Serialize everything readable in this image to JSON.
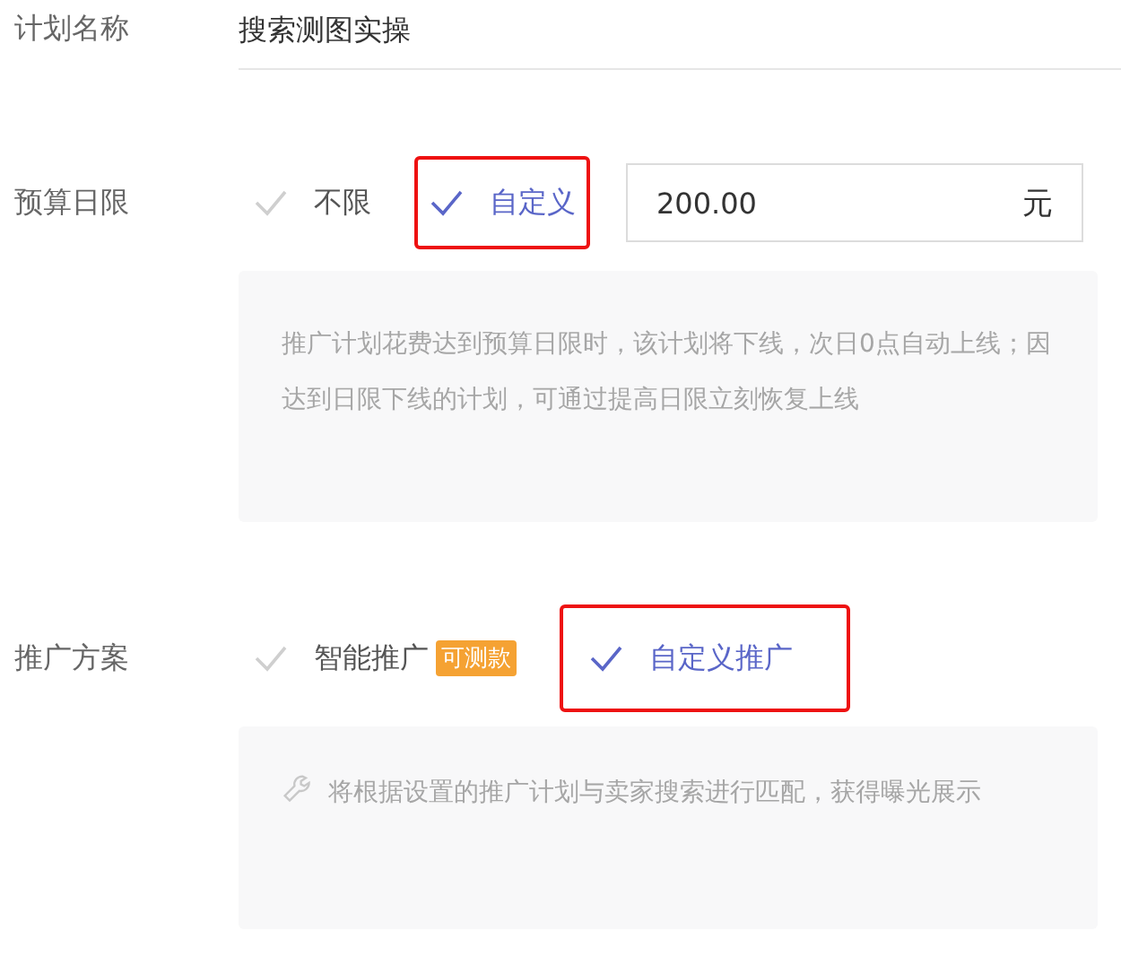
{
  "plan_name": {
    "label": "计划名称",
    "value": "搜索测图实操"
  },
  "budget": {
    "label": "预算日限",
    "options": [
      {
        "label": "不限",
        "selected": false,
        "highlighted": false
      },
      {
        "label": "自定义",
        "selected": true,
        "highlighted": true
      }
    ],
    "amount": {
      "value": "200.00",
      "unit": "元"
    },
    "help": "推广计划花费达到预算日限时，该计划将下线，次日0点自动上线；因达到日限下线的计划，可通过提高日限立刻恢复上线"
  },
  "scheme": {
    "label": "推广方案",
    "options": [
      {
        "label": "智能推广",
        "badge": "可测款",
        "selected": false,
        "highlighted": false
      },
      {
        "label": "自定义推广",
        "selected": true,
        "highlighted": true
      }
    ],
    "help": "将根据设置的推广计划与卖家搜索进行匹配，获得曝光展示"
  }
}
